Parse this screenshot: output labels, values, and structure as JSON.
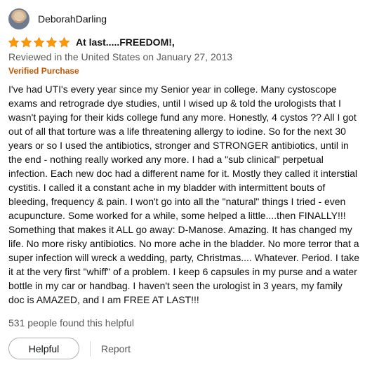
{
  "review": {
    "author": "DeborahDarling",
    "rating": 5,
    "title": "At last.....FREEDOM!,",
    "date_text": "Reviewed in the United States on January 27, 2013",
    "verified_text": "Verified Purchase",
    "body": "I've had UTI's every year since my Senior year in college. Many cystoscope exams and retrograde dye studies, until I wised up & told the urologists that I wasn't paying for their kids college fund any more. Honestly, 4 cystos ?? All I got out of all that torture was a life threatening allergy to iodine. So for the next 30 years or so I used the antibiotics, stronger and STRONGER antibiotics, until in the end - nothing really worked any more. I had a \"sub clinical\" perpetual infection. Each new doc had a different name for it. Mostly they called it interstial cystitis. I called it a constant ache in my bladder with intermittent bouts of bleeding, frequency & pain. I won't go into all the \"natural\" things I tried - even acupuncture. Some worked for a while, some helped a little....then FINALLY!!! Something that makes it ALL go away: D-Manose. Amazing. It has changed my life. No more risky antibiotics. No more ache in the bladder. No more terror that a super infection will wreck a wedding, party, Christmas.... Whatever. Period. I take it at the very first \"whiff\" of a problem. I keep 6 capsules in my purse and a water bottle in my car or handbag. I haven't seen the urologist in 3 years, my family doc is AMAZED, and I am FREE AT LAST!!!",
    "helpful_count_text": "531 people found this helpful",
    "helpful_button_label": "Helpful",
    "report_label": "Report"
  },
  "colors": {
    "star": "#ff9900",
    "verified": "#c45500",
    "muted": "#565959",
    "text": "#0f1111"
  },
  "icons": {
    "avatar": "profile-avatar",
    "star": "star-icon"
  }
}
